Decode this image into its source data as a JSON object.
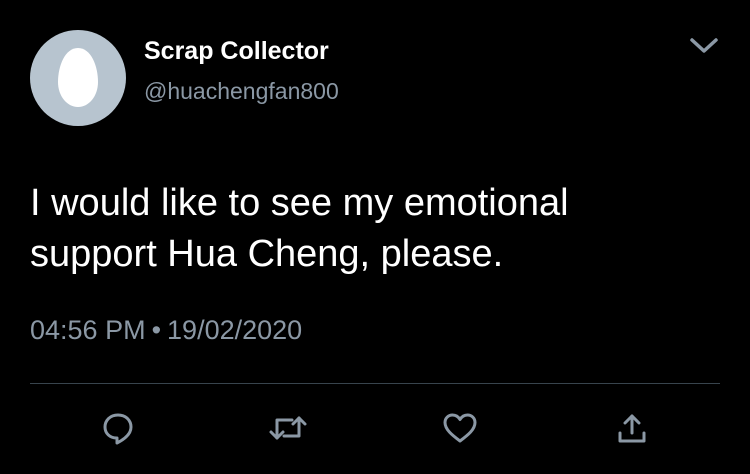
{
  "user": {
    "display_name": "Scrap Collector",
    "handle": "@huachengfan800",
    "avatar": "default-egg-avatar"
  },
  "tweet": {
    "text_line1": "I would like to see my emotional",
    "text_line2": "support Hua Cheng, please.",
    "time": "04:56 PM",
    "separator": "•",
    "date": "19/02/2020"
  },
  "actions": [
    {
      "icon": "reply-icon"
    },
    {
      "icon": "retweet-icon"
    },
    {
      "icon": "like-icon"
    },
    {
      "icon": "share-icon"
    }
  ],
  "menu": {
    "icon": "chevron-down-icon"
  },
  "colors": {
    "background": "#000000",
    "text_primary": "#ffffff",
    "text_secondary": "#8b98a5",
    "divider": "#38444d",
    "avatar_bg": "#b7c4cf"
  }
}
